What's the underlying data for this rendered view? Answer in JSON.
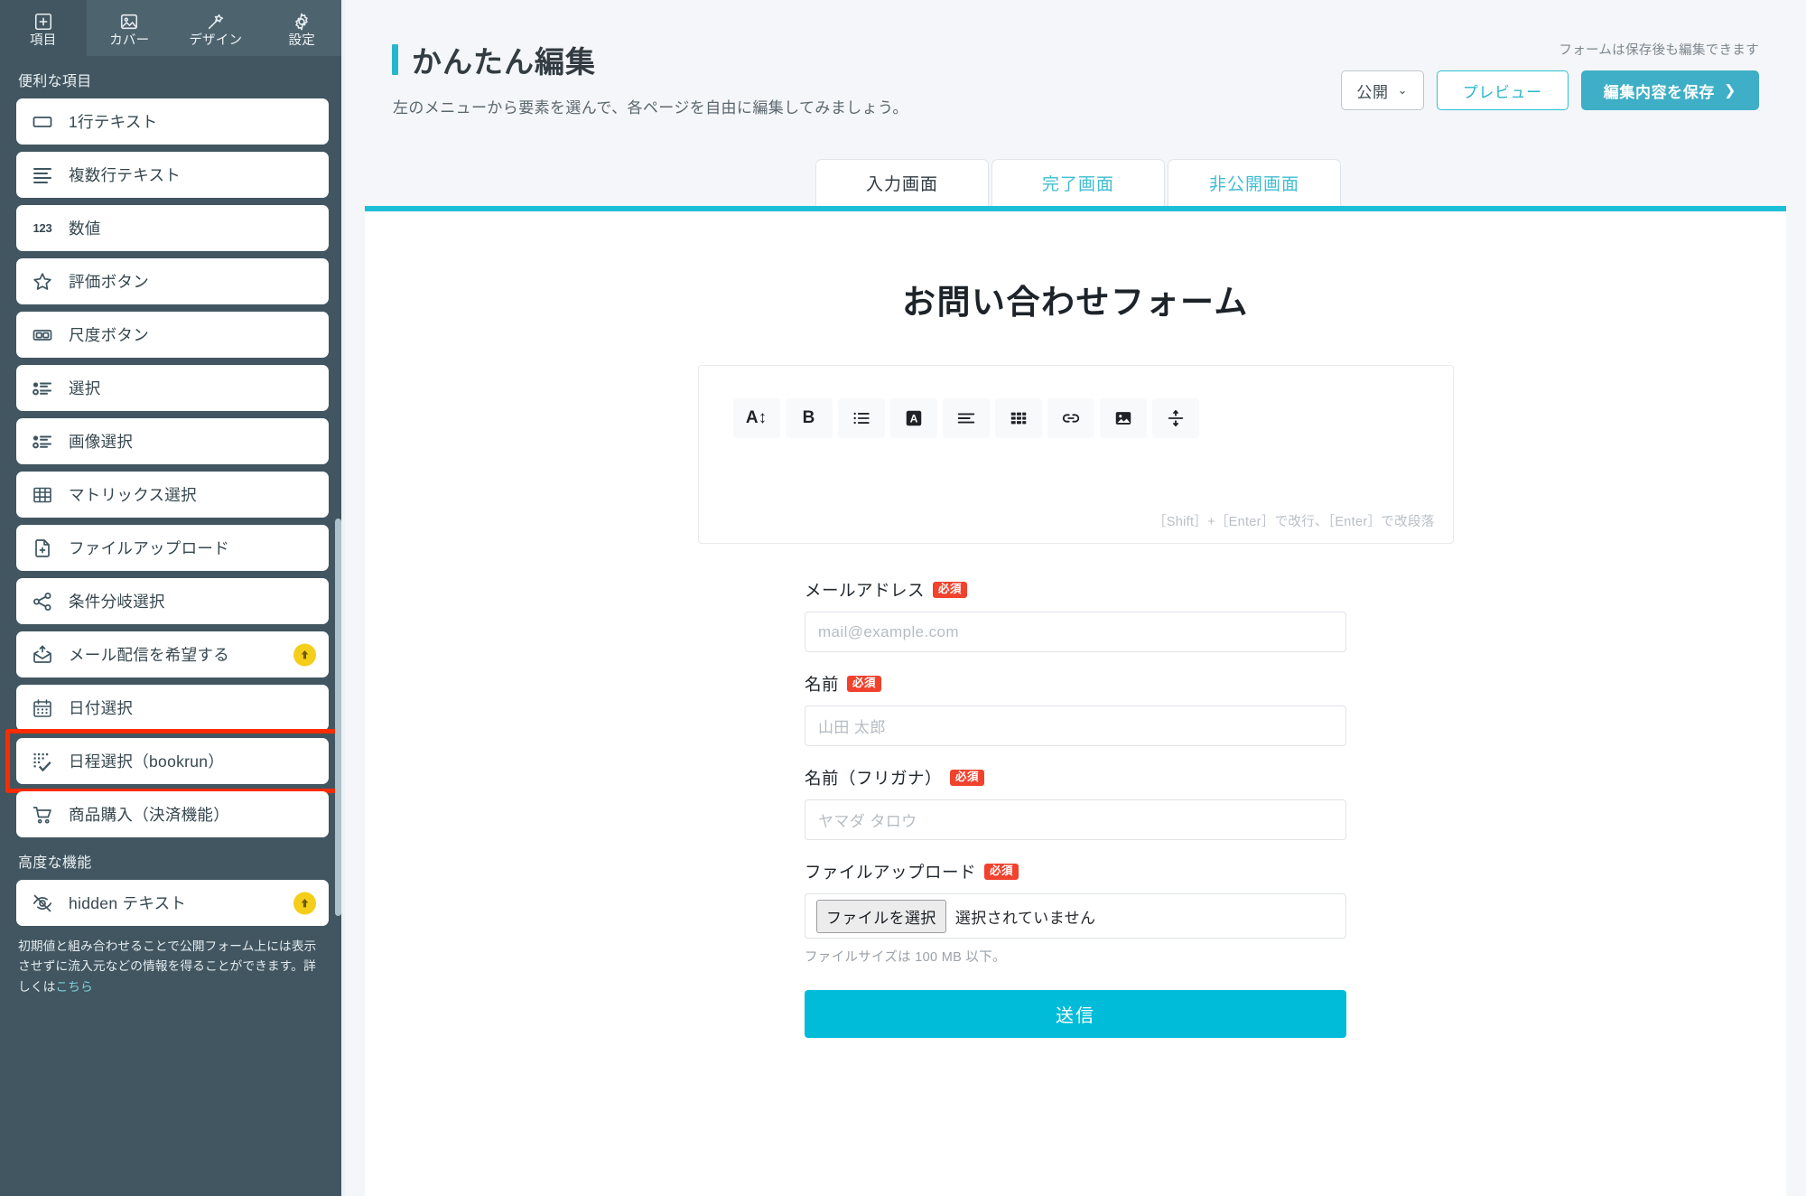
{
  "sidebar": {
    "tabs": [
      {
        "label": "項目",
        "icon": "plus-square-icon",
        "active": true
      },
      {
        "label": "カバー",
        "icon": "image-icon",
        "active": false
      },
      {
        "label": "デザイン",
        "icon": "magic-wand-icon",
        "active": false
      },
      {
        "label": "設定",
        "icon": "gear-icon",
        "active": false
      }
    ],
    "section_basic_heading": "便利な項目",
    "items": [
      {
        "label": "1行テキスト",
        "icon": "single-line-text-icon"
      },
      {
        "label": "複数行テキスト",
        "icon": "multi-line-text-icon"
      },
      {
        "label": "数値",
        "icon": "number-123-icon"
      },
      {
        "label": "評価ボタン",
        "icon": "star-icon"
      },
      {
        "label": "尺度ボタン",
        "icon": "scale-icon"
      },
      {
        "label": "選択",
        "icon": "radio-list-icon"
      },
      {
        "label": "画像選択",
        "icon": "radio-list-icon"
      },
      {
        "label": "マトリックス選択",
        "icon": "grid-table-icon"
      },
      {
        "label": "ファイルアップロード",
        "icon": "file-plus-icon"
      },
      {
        "label": "条件分岐選択",
        "icon": "share-branch-icon"
      },
      {
        "label": "メール配信を希望する",
        "icon": "mail-upload-icon",
        "upsell": true
      },
      {
        "label": "日付選択",
        "icon": "calendar-icon"
      },
      {
        "label": "日程選択（bookrun）",
        "icon": "schedule-check-icon",
        "highlighted": true
      },
      {
        "label": "商品購入（決済機能）",
        "icon": "shopping-cart-icon"
      }
    ],
    "section_advanced_heading": "高度な機能",
    "advanced_items": [
      {
        "label": "hidden テキスト",
        "icon": "eye-off-icon",
        "upsell": true
      }
    ],
    "footnote_text": "初期値と組み合わせることで公開フォーム上には表示させずに流入元などの情報を得ることができます。詳しくは",
    "footnote_link": "こちら",
    "highlight_color": "#fd2b00"
  },
  "header": {
    "title": "かんたん編集",
    "subtitle": "左のメニューから要素を選んで、各ページを自由に編集してみましょう。",
    "save_note": "フォームは保存後も編集できます",
    "status_button": "公開",
    "status_chevron": "⌄",
    "preview_button": "プレビュー",
    "save_button": "編集内容を保存",
    "save_chevron": "❯",
    "accent_color": "#26b7cd"
  },
  "tabs": [
    {
      "label": "入力画面",
      "active": true
    },
    {
      "label": "完了画面",
      "active": false
    },
    {
      "label": "非公開画面",
      "active": false
    }
  ],
  "canvas": {
    "form_title": "お問い合わせフォーム",
    "editor": {
      "toolbar": [
        {
          "name": "font-size-icon",
          "glyph": "A↕"
        },
        {
          "name": "bold-icon",
          "glyph": "B"
        },
        {
          "name": "bullet-list-icon",
          "glyph": "list"
        },
        {
          "name": "text-color-icon",
          "glyph": "A-filled"
        },
        {
          "name": "align-icon",
          "glyph": "align"
        },
        {
          "name": "table-icon",
          "glyph": "table"
        },
        {
          "name": "link-icon",
          "glyph": "link"
        },
        {
          "name": "image-icon",
          "glyph": "image"
        },
        {
          "name": "divider-icon",
          "glyph": "divider"
        }
      ],
      "hint": "［Shift］+［Enter］で改行、［Enter］で改段落"
    },
    "fields": [
      {
        "label": "メールアドレス",
        "required_badge": "必須",
        "type": "text",
        "placeholder": "mail@example.com"
      },
      {
        "label": "名前",
        "required_badge": "必須",
        "type": "text",
        "placeholder": "山田 太郎"
      },
      {
        "label": "名前（フリガナ）",
        "required_badge": "必須",
        "type": "text",
        "placeholder": "ヤマダ タロウ"
      },
      {
        "label": "ファイルアップロード",
        "required_badge": "必須",
        "type": "file",
        "file_button": "ファイルを選択",
        "file_status": "選択されていません",
        "note": "ファイルサイズは 100 MB 以下。"
      }
    ],
    "submit_button": "送信",
    "submit_color": "#00bcd8",
    "top_border_color": "#1cbfd6"
  }
}
